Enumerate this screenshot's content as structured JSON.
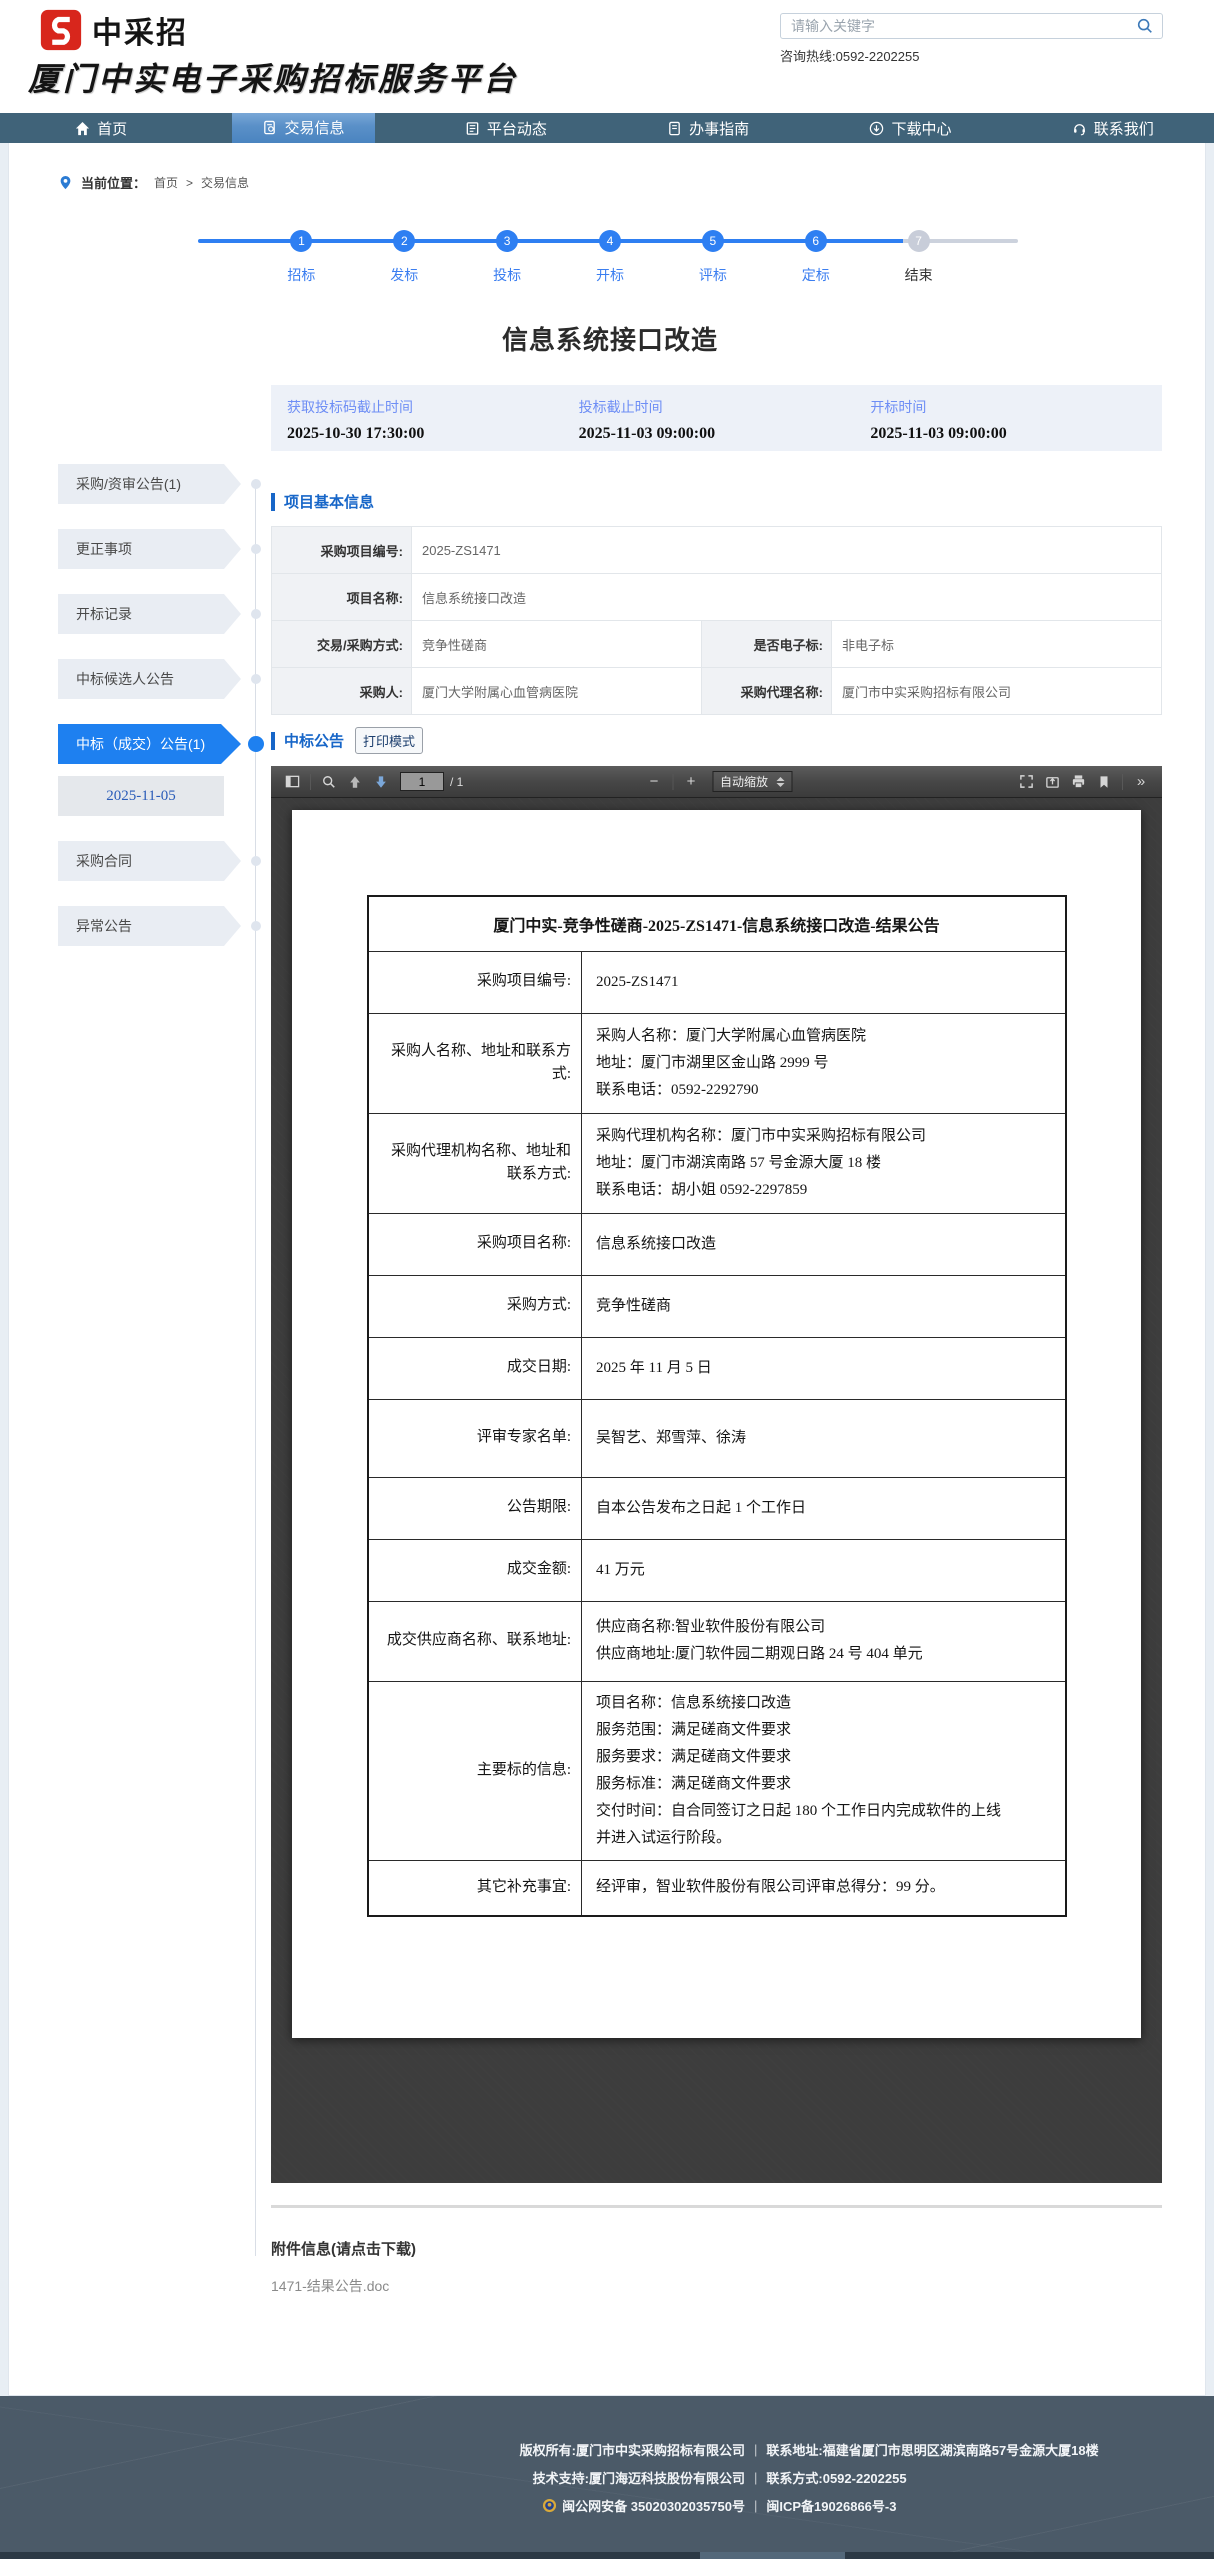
{
  "colors": {
    "accent_blue": "#1e80f0",
    "nav_bg": "#406379",
    "nav_active_top": "#8cb6e0",
    "nav_active_bottom": "#4a84c0",
    "stepper_blue": "#2e7ff2",
    "stepper_gray": "#c8cdd9",
    "section_blue": "#1766c8",
    "deadline_label": "#6e8ef5",
    "logo_red": "#d8261c",
    "pdf_toolbar": "#474747",
    "pdf_body": "#3d3d3d",
    "footer_bg": "#4b5a68"
  },
  "header": {
    "logo_text": "中采招",
    "subtitle": "厦门中实电子采购招标服务平台",
    "search_placeholder": "请输入关键字",
    "hotline": "咨询热线:0592-2202255"
  },
  "nav": {
    "items": [
      {
        "label": "首页"
      },
      {
        "label": "交易信息"
      },
      {
        "label": "平台动态"
      },
      {
        "label": "办事指南"
      },
      {
        "label": "下载中心"
      },
      {
        "label": "联系我们"
      }
    ],
    "active_item": "交易信息"
  },
  "breadcrumb": {
    "label": "当前位置：",
    "home": "首页",
    "separator": ">",
    "current": "交易信息"
  },
  "stepper": {
    "steps": [
      {
        "num": "1",
        "label": "招标"
      },
      {
        "num": "2",
        "label": "发标"
      },
      {
        "num": "3",
        "label": "投标"
      },
      {
        "num": "4",
        "label": "开标"
      },
      {
        "num": "5",
        "label": "评标"
      },
      {
        "num": "6",
        "label": "定标"
      },
      {
        "num": "7",
        "label": "结束"
      }
    ],
    "completed_steps": 6
  },
  "page_title": "信息系统接口改造",
  "deadlines": [
    {
      "label": "获取投标码截止时间",
      "value": "2025-10-30 17:30:00"
    },
    {
      "label": "投标截止时间",
      "value": "2025-11-03 09:00:00"
    },
    {
      "label": "开标时间",
      "value": "2025-11-03 09:00:00"
    }
  ],
  "sidebar": {
    "items": [
      "采购/资审公告(1)",
      "更正事项",
      "开标记录",
      "中标候选人公告",
      "中标（成交）公告(1)",
      "采购合同",
      "异常公告"
    ],
    "active_item": "中标（成交）公告(1)",
    "date_item": "2025-11-05"
  },
  "sections": {
    "basic_info_title": "项目基本信息",
    "award_title": "中标公告",
    "print_button": "打印模式"
  },
  "basic_info": {
    "rows": [
      {
        "label": "采购项目编号:",
        "value": "2025-ZS1471"
      },
      {
        "label": "项目名称:",
        "value": "信息系统接口改造"
      },
      {
        "label": "交易/采购方式:",
        "value": "竞争性磋商",
        "label2": "是否电子标:",
        "value2": "非电子标"
      },
      {
        "label": "采购人:",
        "value": "厦门大学附属心血管病医院",
        "label2": "采购代理名称:",
        "value2": "厦门市中实采购招标有限公司"
      }
    ]
  },
  "pdf": {
    "toolbar": {
      "page_current": "1",
      "page_total": "/ 1",
      "minus": "−",
      "plus": "+",
      "zoom_label": "自动缩放",
      "more": "»"
    }
  },
  "doc": {
    "title": "厦门中实-竞争性磋商-2025-ZS1471-信息系统接口改造-结果公告",
    "rows": [
      {
        "label": "采购项目编号:",
        "lines": [
          "2025-ZS1471"
        ]
      },
      {
        "label": "采购人名称、地址和联系方式:",
        "lines": [
          "采购人名称：厦门大学附属心血管病医院",
          "地址：厦门市湖里区金山路 2999 号",
          "联系电话：0592-2292790"
        ]
      },
      {
        "label": "采购代理机构名称、地址和联系方式:",
        "lines": [
          "采购代理机构名称：厦门市中实采购招标有限公司",
          "地址：厦门市湖滨南路 57 号金源大厦 18 楼",
          "联系电话：胡小姐 0592-2297859"
        ]
      },
      {
        "label": "采购项目名称:",
        "lines": [
          "信息系统接口改造"
        ]
      },
      {
        "label": "采购方式:",
        "lines": [
          "竞争性磋商"
        ]
      },
      {
        "label": "成交日期:",
        "lines": [
          "2025 年 11 月 5 日"
        ]
      },
      {
        "label": "评审专家名单:",
        "lines": [
          "吴智艺、郑雪萍、徐涛"
        ]
      },
      {
        "label": "公告期限:",
        "lines": [
          "自本公告发布之日起 1 个工作日"
        ]
      },
      {
        "label": "成交金额:",
        "lines": [
          "41 万元"
        ]
      },
      {
        "label": "成交供应商名称、联系地址:",
        "lines": [
          "供应商名称:智业软件股份有限公司",
          "供应商地址:厦门软件园二期观日路 24 号 404 单元"
        ]
      },
      {
        "label": "主要标的信息:",
        "lines": [
          "项目名称：信息系统接口改造",
          "服务范围：满足磋商文件要求",
          "服务要求：满足磋商文件要求",
          "服务标准：满足磋商文件要求",
          "交付时间：自合同签订之日起 180 个工作日内完成软件的上线",
          "并进入试运行阶段。"
        ]
      },
      {
        "label": "其它补充事宜:",
        "lines": [
          "经评审，智业软件股份有限公司评审总得分：99 分。"
        ]
      }
    ]
  },
  "attachments": {
    "heading": "附件信息(请点击下载)",
    "files": [
      "1471-结果公告.doc"
    ]
  },
  "footer": {
    "divider": "|",
    "rows": [
      {
        "left": "版权所有:厦门市中实采购招标有限公司",
        "right": "联系地址:福建省厦门市思明区湖滨南路57号金源大厦18楼"
      },
      {
        "left": "技术支持:厦门海迈科技股份有限公司",
        "right": "联系方式:0592-2202255"
      },
      {
        "left": "闽公网安备 35020302035750号",
        "right": "闽ICP备19026866号-3"
      }
    ]
  }
}
